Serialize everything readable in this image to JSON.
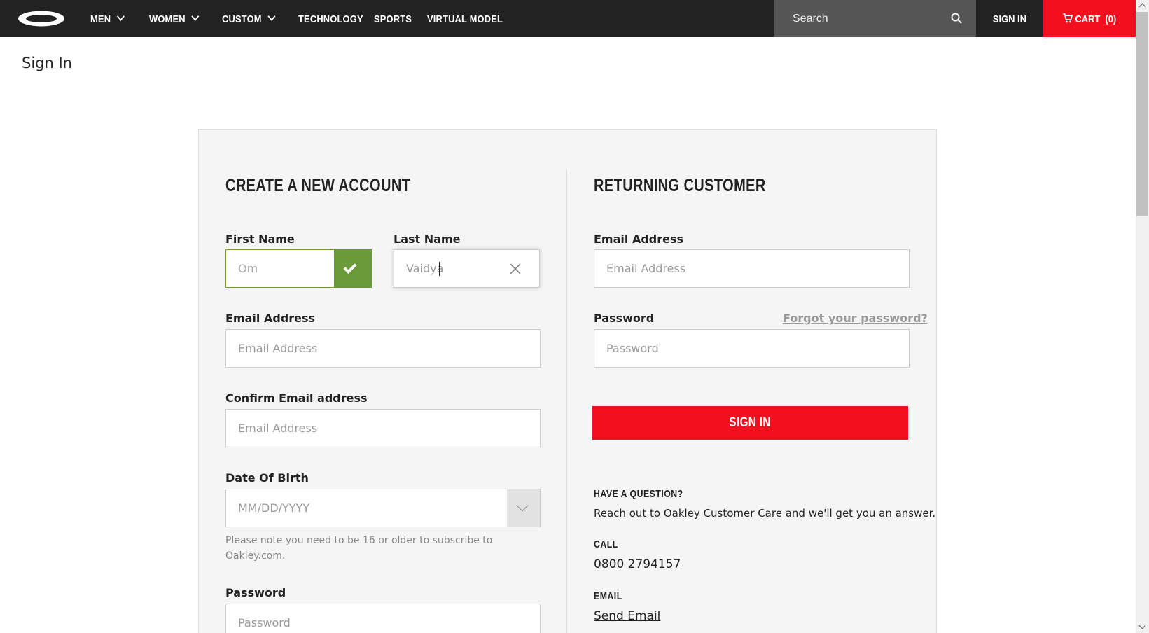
{
  "nav": {
    "items": [
      {
        "label": "MEN",
        "has_dropdown": true
      },
      {
        "label": "WOMEN",
        "has_dropdown": true
      },
      {
        "label": "CUSTOM",
        "has_dropdown": true
      },
      {
        "label": "TECHNOLOGY",
        "has_dropdown": false
      },
      {
        "label": "SPORTS",
        "has_dropdown": false
      },
      {
        "label": "VIRTUAL MODEL",
        "has_dropdown": false
      }
    ],
    "search_placeholder": "Search",
    "signin_label": "SIGN IN",
    "cart_label": "CART",
    "cart_count": "(0)",
    "colors": {
      "bar": "#222222",
      "search": "#555555",
      "cart": "#f2101e"
    }
  },
  "page": {
    "title": "Sign In"
  },
  "create": {
    "title": "CREATE A NEW ACCOUNT",
    "first_name": {
      "label": "First Name",
      "value": "Om",
      "valid": true
    },
    "last_name": {
      "label": "Last Name",
      "value": "Vaidya"
    },
    "email": {
      "label": "Email Address",
      "placeholder": "Email Address"
    },
    "confirm_email": {
      "label": "Confirm Email address",
      "placeholder": "Email Address"
    },
    "dob": {
      "label": "Date Of Birth",
      "placeholder": "MM/DD/YYYY",
      "note": "Please note you need to be 16 or older to subscribe to Oakley.com."
    },
    "password": {
      "label": "Password",
      "placeholder": "Password"
    },
    "colors": {
      "valid": "#6b9a3a"
    }
  },
  "returning": {
    "title": "RETURNING CUSTOMER",
    "email": {
      "label": "Email Address",
      "placeholder": "Email Address"
    },
    "password": {
      "label": "Password",
      "placeholder": "Password"
    },
    "forgot_label": "Forgot your password?",
    "signin_label": "SIGN IN",
    "question_title": "HAVE A QUESTION?",
    "question_text": "Reach out to Oakley Customer Care and we'll get you an answer.",
    "call_title": "CALL",
    "phone": "0800 2794157",
    "email_title": "EMAIL",
    "send_email_label": "Send Email"
  }
}
